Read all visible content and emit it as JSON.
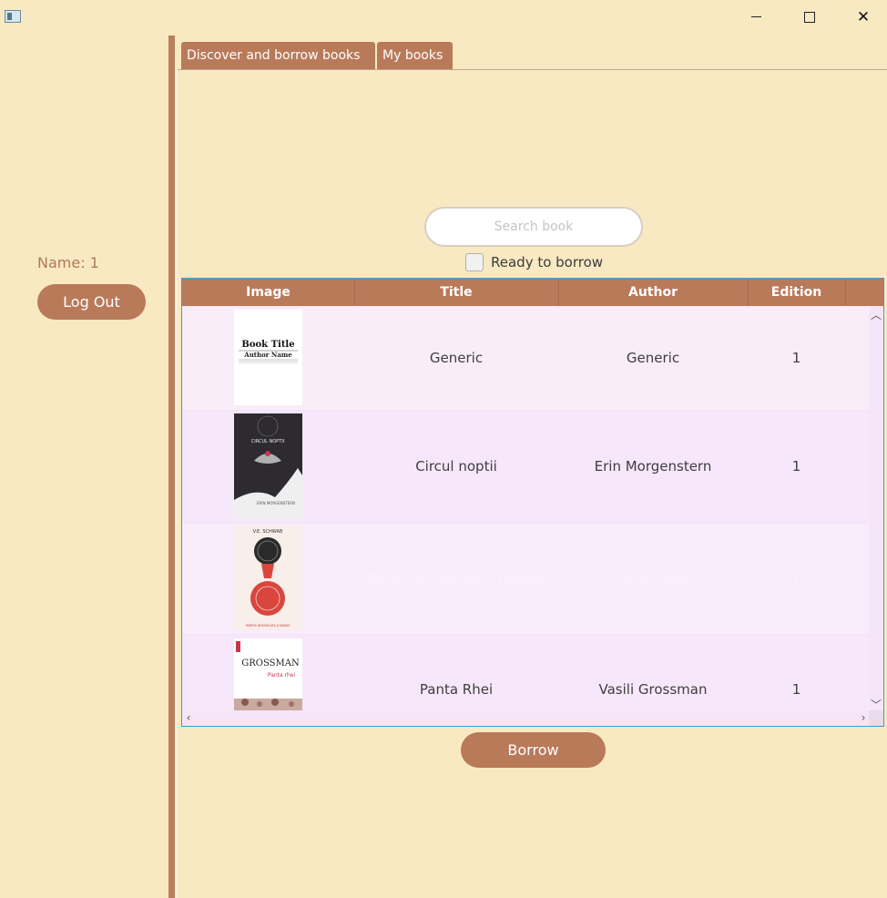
{
  "window": {
    "icon": "app-window-icon",
    "controls": {
      "minimize": "minimize-icon",
      "maximize": "maximize-icon",
      "close": "close-icon"
    }
  },
  "sidebar": {
    "user_label": "Name: 1",
    "logout_label": "Log Out"
  },
  "tabs": [
    {
      "label": "Discover and borrow books",
      "active": true
    },
    {
      "label": "My books",
      "active": false
    }
  ],
  "search": {
    "placeholder": "Search book",
    "value": ""
  },
  "filter": {
    "ready_label": "Ready to borrow",
    "checked": false
  },
  "table": {
    "columns": [
      "Image",
      "Title",
      "Author",
      "Edition"
    ],
    "rows": [
      {
        "cover": "Book Title",
        "cover_sub": "Author Name",
        "title": "Generic",
        "author": "Generic",
        "edition": "1"
      },
      {
        "cover": "CIRCUL NOPTII",
        "cover_sub": "ERIN MORGENSTERN",
        "title": "Circul noptii",
        "author": "Erin Morgenstern",
        "edition": "1"
      },
      {
        "cover": "V.E. SCHWAB",
        "cover_sub": "PARTEA INTUNECATA A MAGIEI",
        "title": "Parte intunecata a magiei",
        "author": "V.E. Schwab",
        "edition": "1"
      },
      {
        "cover": "GROSSMAN",
        "cover_sub": "Panta rhei",
        "title": "Panta Rhei",
        "author": "Vasili Grossman",
        "edition": "1"
      }
    ]
  },
  "borrow_label": "Borrow",
  "colors": {
    "background": "#f9e9c2",
    "accent": "#b97a5a",
    "table_row": "#f6e7fa",
    "selection_border": "#2ea3d7"
  }
}
